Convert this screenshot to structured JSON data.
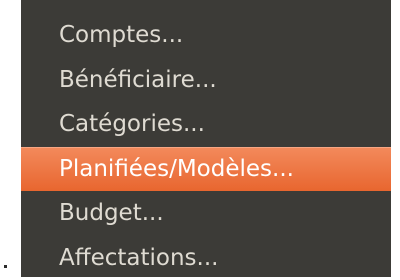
{
  "menu": {
    "selected_index": 3,
    "items": [
      {
        "label": "Comptes..."
      },
      {
        "label": "Bénéficiaire..."
      },
      {
        "label": "Catégories..."
      },
      {
        "label": "Planifiées/Modèles..."
      },
      {
        "label": "Budget..."
      },
      {
        "label": "Affectations..."
      }
    ]
  },
  "colors": {
    "menu_background": "#3c3b37",
    "menu_text": "#dfdbd2",
    "highlight": "#e8662f",
    "highlight_text": "#ffffff"
  }
}
